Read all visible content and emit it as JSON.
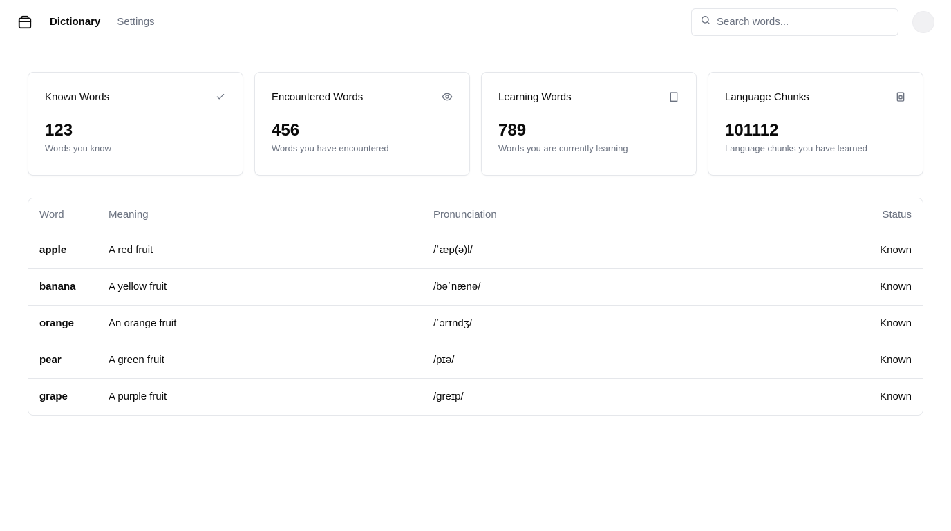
{
  "nav": {
    "logo_icon": "package-icon",
    "dictionary": "Dictionary",
    "settings": "Settings"
  },
  "search": {
    "placeholder": "Search words...",
    "value": ""
  },
  "cards": [
    {
      "title": "Known Words",
      "icon": "check-icon",
      "value": "123",
      "subtitle": "Words you know"
    },
    {
      "title": "Encountered Words",
      "icon": "eye-icon",
      "value": "456",
      "subtitle": "Words you have encountered"
    },
    {
      "title": "Learning Words",
      "icon": "book-icon",
      "value": "789",
      "subtitle": "Words you are currently learning"
    },
    {
      "title": "Language Chunks",
      "icon": "file-icon",
      "value": "101112",
      "subtitle": "Language chunks you have learned"
    }
  ],
  "table": {
    "headers": {
      "word": "Word",
      "meaning": "Meaning",
      "pronunciation": "Pronunciation",
      "status": "Status"
    },
    "rows": [
      {
        "word": "apple",
        "meaning": "A red fruit",
        "pronunciation": "/ˈæp(ə)l/",
        "status": "Known"
      },
      {
        "word": "banana",
        "meaning": "A yellow fruit",
        "pronunciation": "/bəˈnænə/",
        "status": "Known"
      },
      {
        "word": "orange",
        "meaning": "An orange fruit",
        "pronunciation": "/ˈɔrɪndʒ/",
        "status": "Known"
      },
      {
        "word": "pear",
        "meaning": "A green fruit",
        "pronunciation": "/pɪə/",
        "status": "Known"
      },
      {
        "word": "grape",
        "meaning": "A purple fruit",
        "pronunciation": "/greɪp/",
        "status": "Known"
      }
    ]
  }
}
